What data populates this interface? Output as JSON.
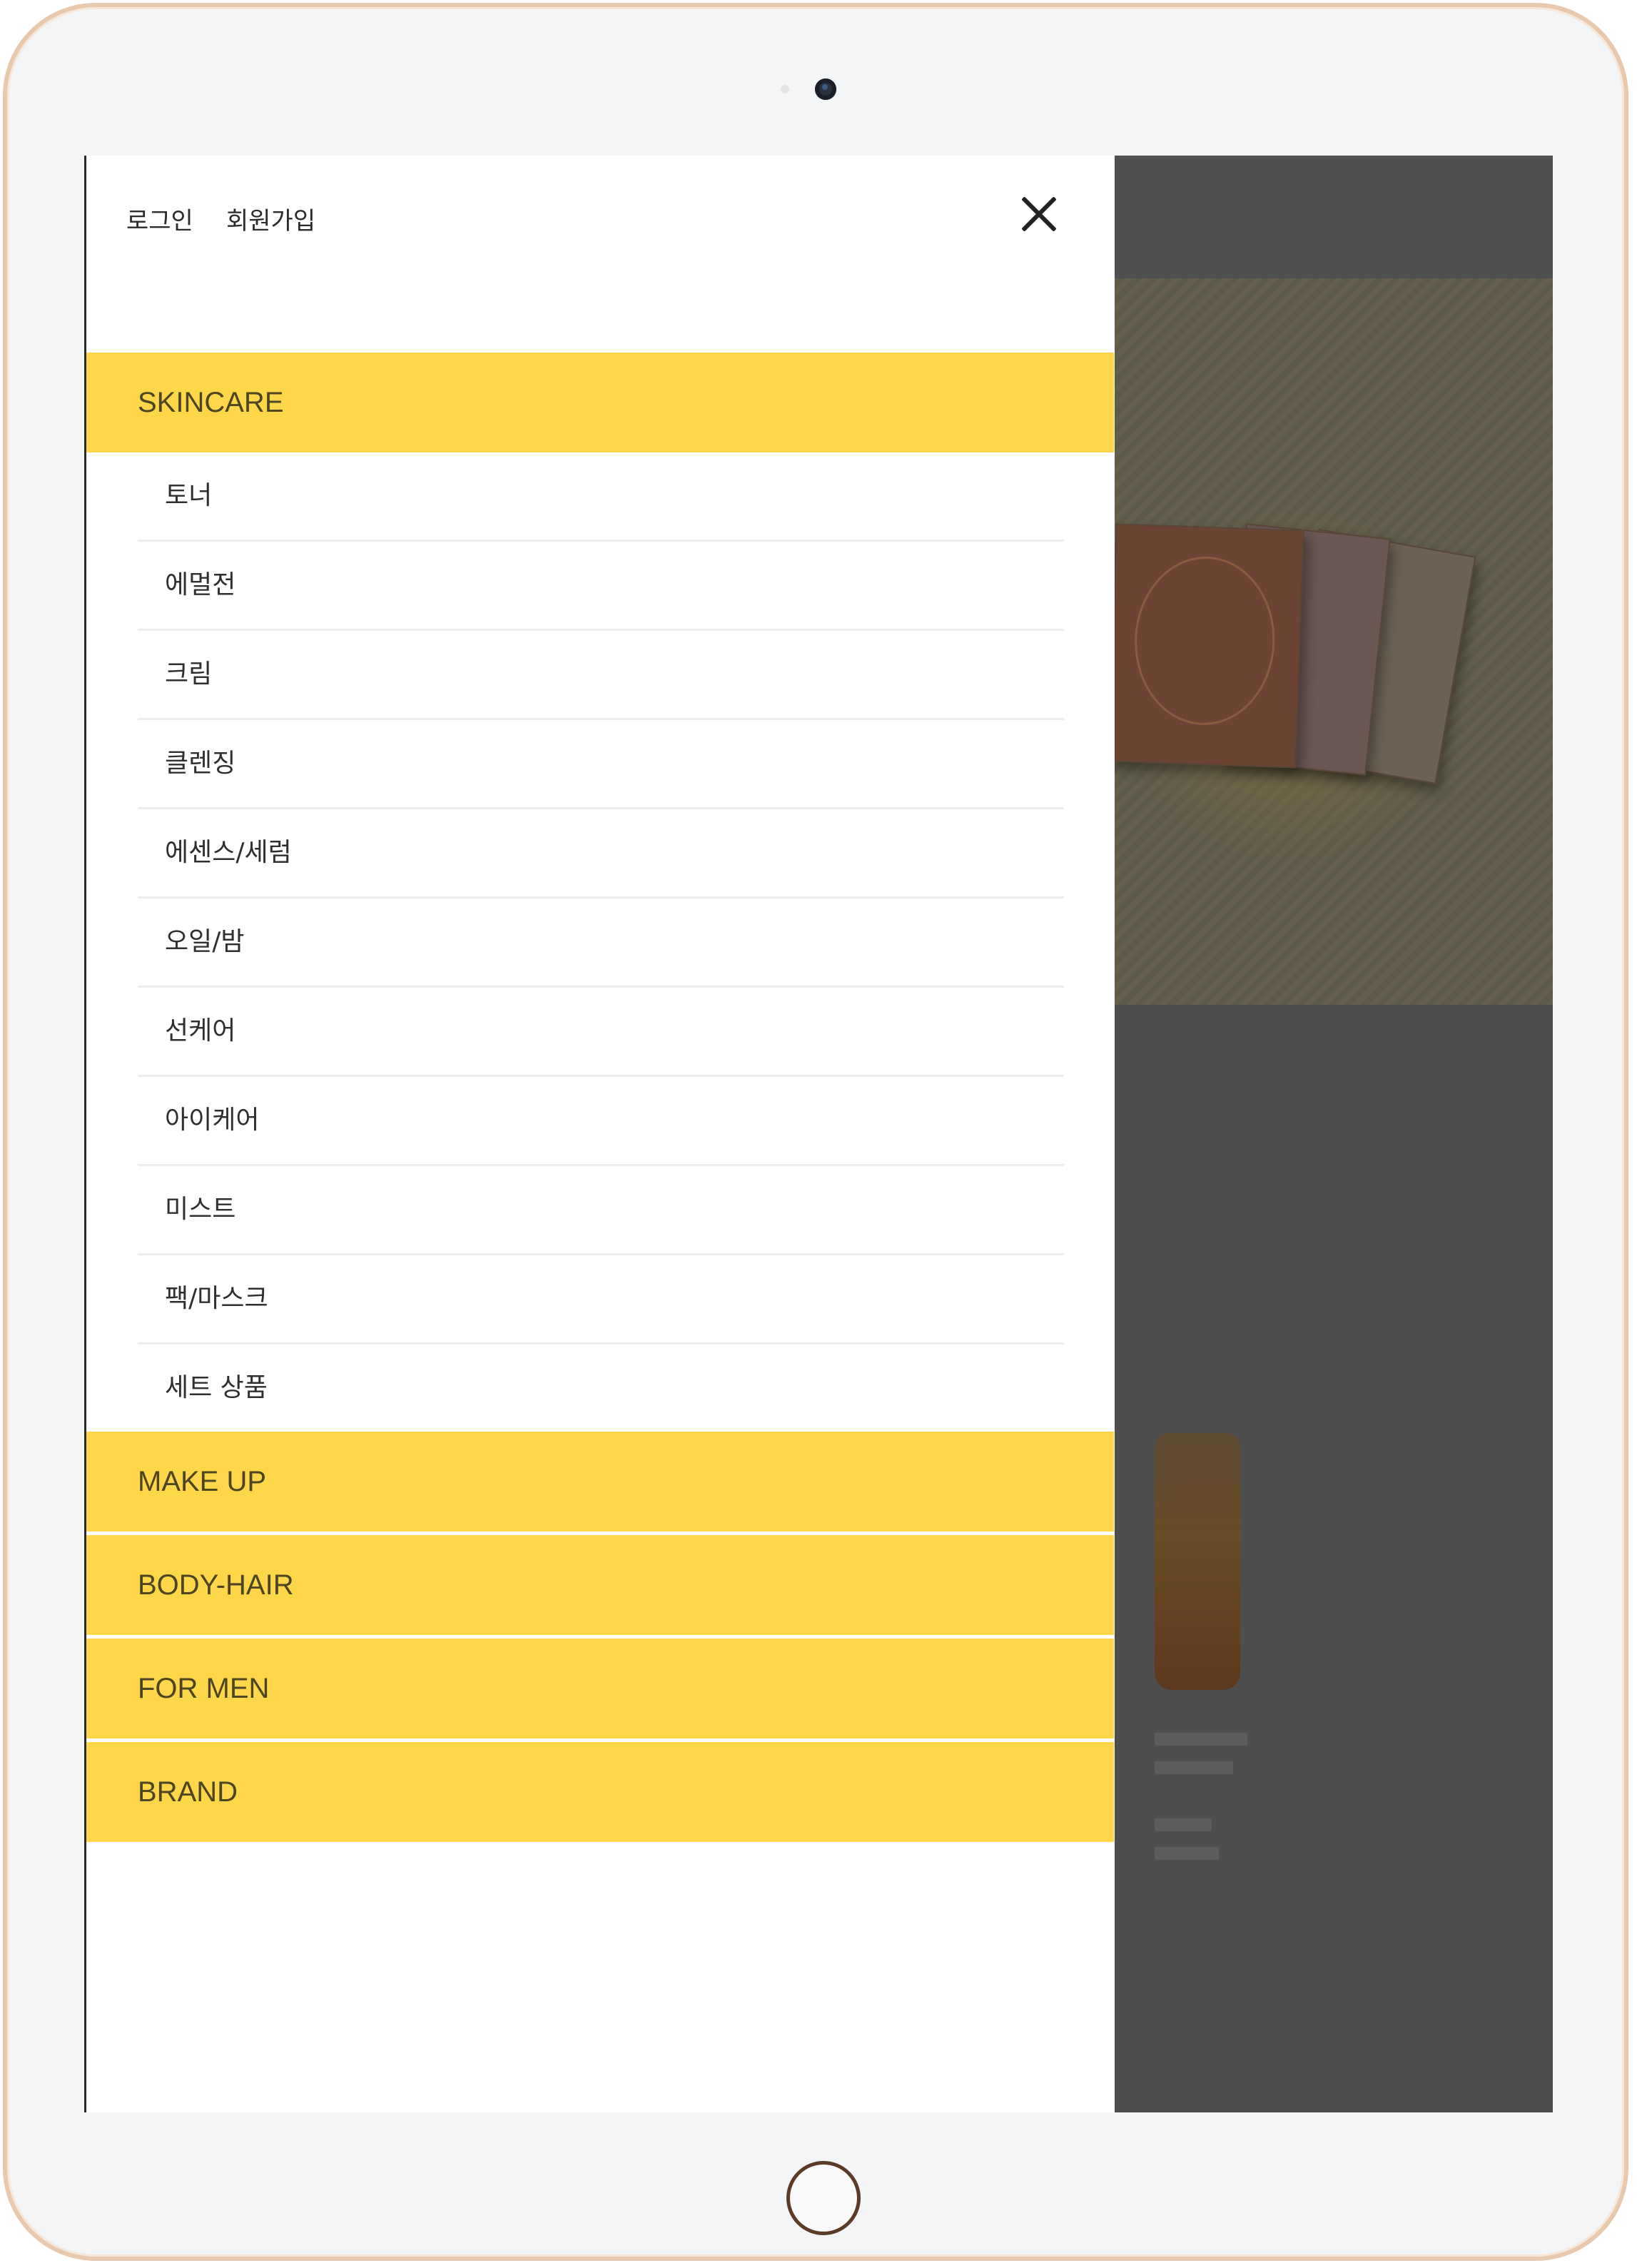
{
  "header": {
    "login_label": "로그인",
    "signup_label": "회원가입"
  },
  "menu": {
    "categories": [
      {
        "label": "SKINCARE"
      },
      {
        "label": "MAKE UP"
      },
      {
        "label": "BODY-HAIR"
      },
      {
        "label": "FOR MEN"
      },
      {
        "label": "BRAND"
      }
    ],
    "skincare_items": [
      {
        "label": "토너"
      },
      {
        "label": "에멀전"
      },
      {
        "label": "크림"
      },
      {
        "label": "클렌징"
      },
      {
        "label": "에센스/세럼"
      },
      {
        "label": "오일/밤"
      },
      {
        "label": "선케어"
      },
      {
        "label": "아이케어"
      },
      {
        "label": "미스트"
      },
      {
        "label": "팩/마스크"
      },
      {
        "label": "세트 상품"
      }
    ]
  },
  "colors": {
    "category_bg": "#fed64a",
    "category_text": "#4f4522",
    "overlay": "#4e4e4e"
  },
  "icons": {
    "close": "close-icon",
    "camera": "camera-icon",
    "home": "home-button-icon"
  }
}
